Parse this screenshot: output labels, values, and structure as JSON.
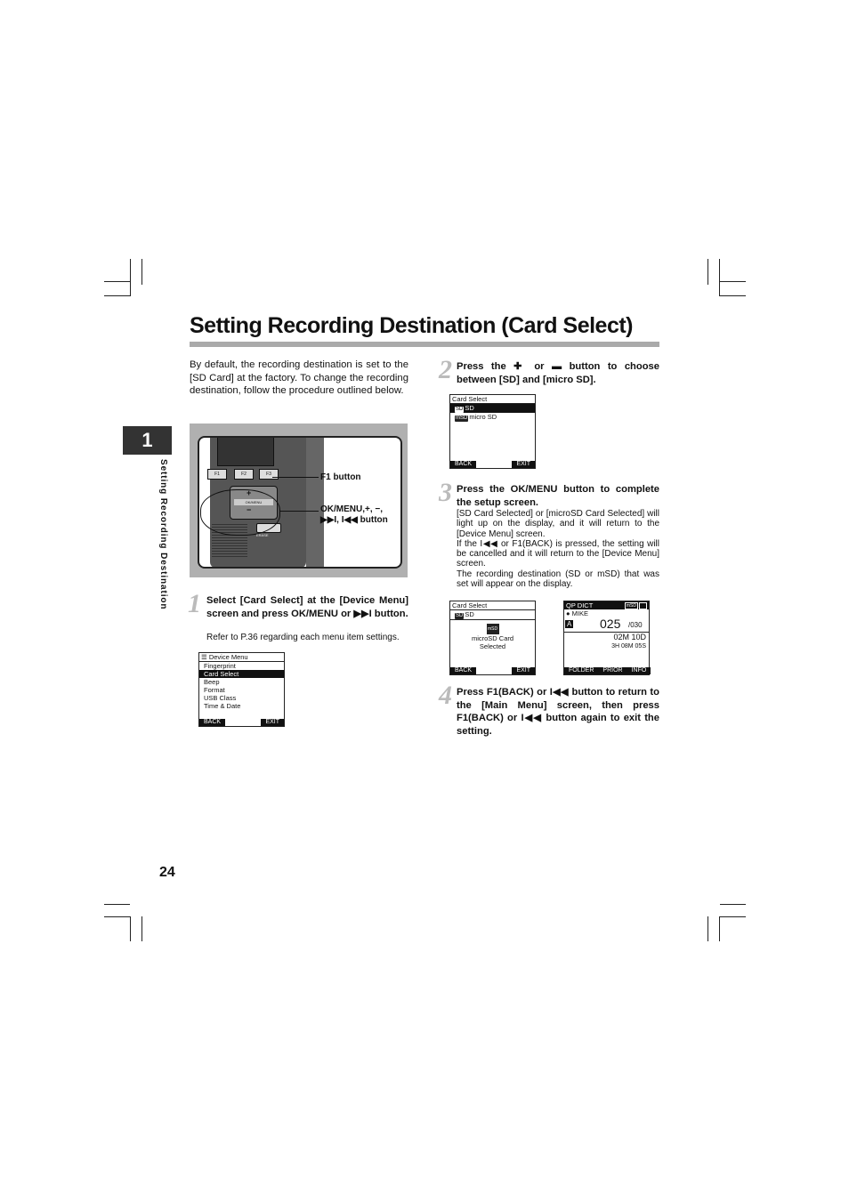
{
  "title": "Setting Recording Destination (Card Select)",
  "intro": "By default, the recording destination is set to the [SD Card] at the factory. To change the recording destination, follow the procedure outlined below.",
  "chapter": {
    "number": "1",
    "side_label": "Setting Recording Destination"
  },
  "page_number": "24",
  "device_labels": {
    "f1": "F1 button",
    "ok_line1": "OK/MENU,+, −,",
    "ok_line2": "▶▶I, I◀◀ button",
    "key_f1": "F1",
    "key_f2": "F2",
    "key_f3": "F3",
    "key_center": "OK/MENU",
    "key_erase": "ERASE"
  },
  "steps": [
    {
      "number": "1",
      "text": "Select [Card Select] at the [Device Menu] screen and press OK/MENU or ▶▶I button.",
      "note": "Refer to P.36 regarding each menu item settings."
    },
    {
      "number": "2",
      "text": "Press the ✚ or ▬ button to choose between [SD] and [micro SD]."
    },
    {
      "number": "3",
      "text": "Press the OK/MENU button to complete the setup screen.",
      "note1": "[SD Card Selected] or [microSD Card Selected] will light up on the display, and it will return to the [Device Menu] screen.",
      "note2": "If the I◀◀ or F1(BACK) is pressed, the setting will be cancelled and it will return to the [Device Menu] screen.",
      "note3": "The recording destination (SD or mSD) that was set will appear on the display."
    },
    {
      "number": "4",
      "text": "Press F1(BACK) or I◀◀ button to return to the [Main Menu] screen, then press F1(BACK) or I◀◀ button again to exit the setting."
    }
  ],
  "screen_device_menu": {
    "header": "Device Menu",
    "items": [
      "Fingerprint",
      "Card Select",
      "Beep",
      "Format",
      "USB Class",
      "Time & Date"
    ],
    "selected": "Card Select",
    "back": "BACK",
    "exit": "EXIT"
  },
  "screen_card_select": {
    "header": "Card Select",
    "items": [
      "SD",
      "micro SD"
    ],
    "chips": [
      "SD",
      "mSD"
    ],
    "selected": "SD",
    "back": "BACK",
    "exit": "EXIT"
  },
  "screen_card_selected": {
    "header": "Card Select",
    "item": "SD",
    "chip_sd": "SD",
    "chip": "mSD",
    "line1": "microSD Card",
    "line2": "Selected",
    "back": "BACK",
    "exit": "EXIT"
  },
  "screen_main": {
    "header": "QP  DICT",
    "badge": "mSD",
    "user": "MIKE",
    "folder": "A",
    "file_count": "025",
    "file_total": "/030",
    "date": "02M 10D",
    "time": "3H 08M 05S",
    "f1": "FOLDER",
    "f2": "PRIOR",
    "f3": "INFO"
  }
}
